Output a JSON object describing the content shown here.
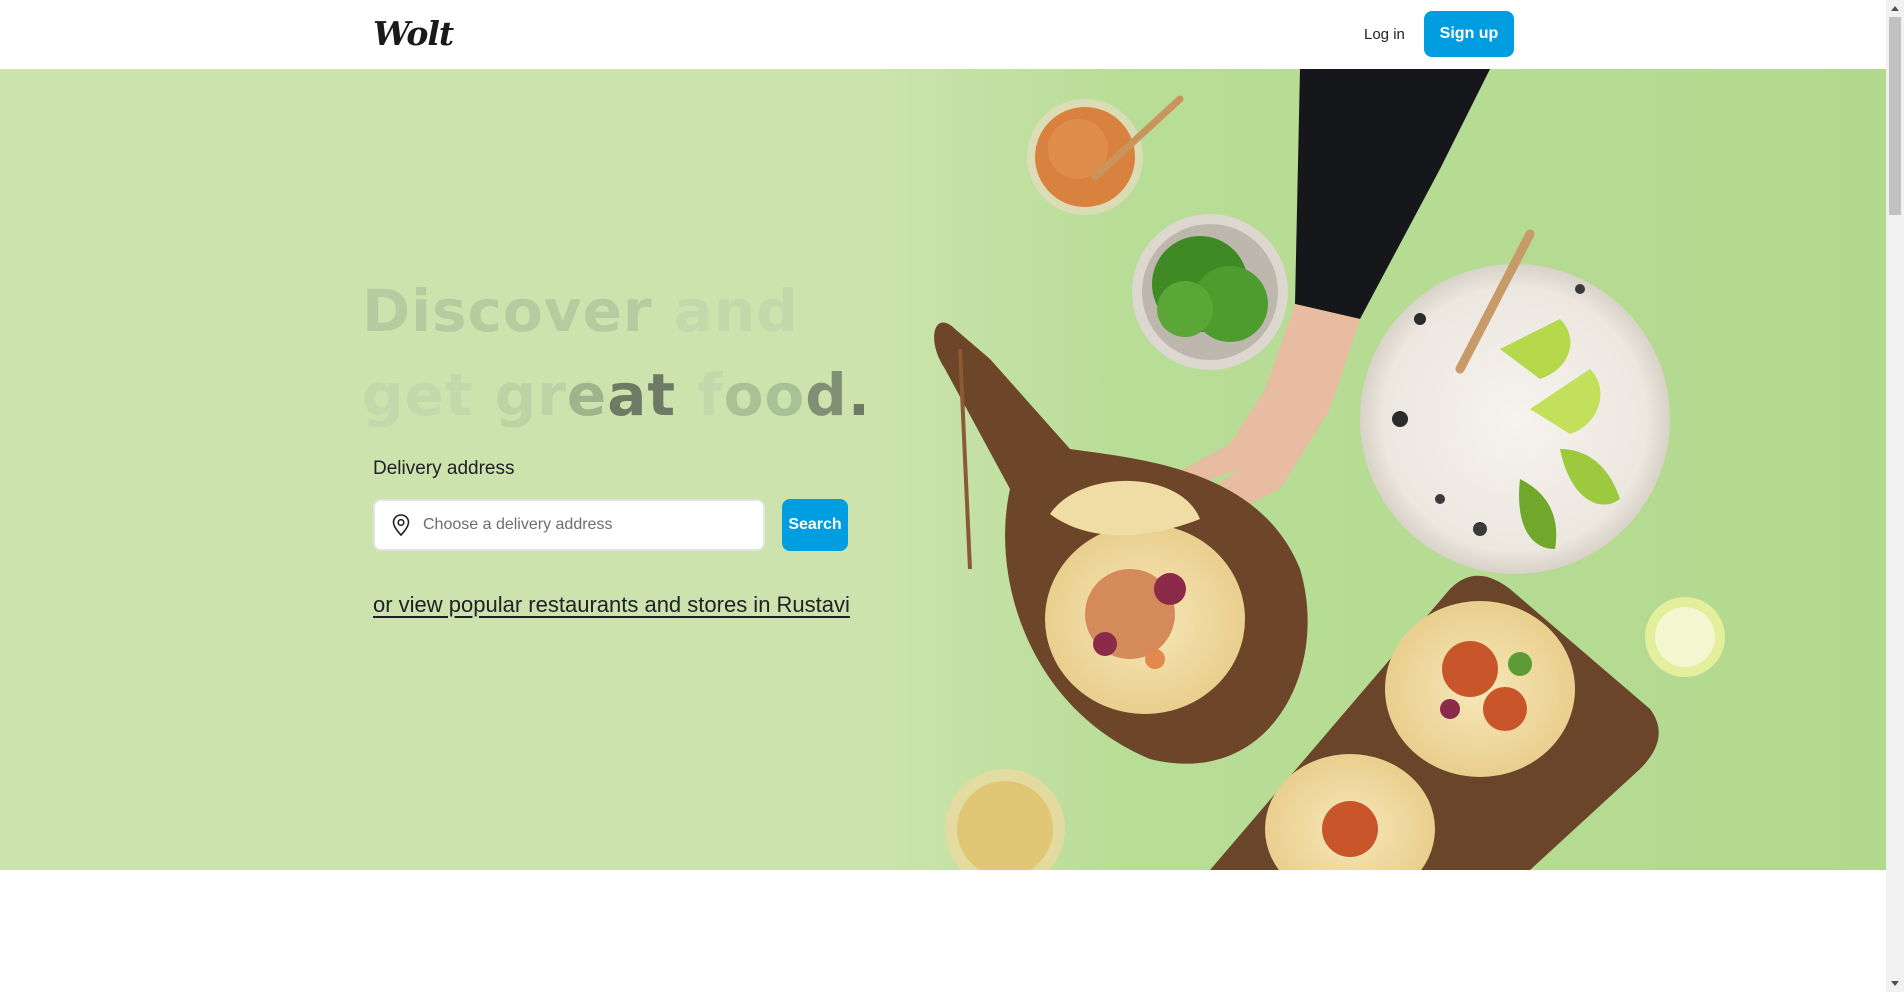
{
  "header": {
    "logo": "Wolt",
    "login_label": "Log in",
    "signup_label": "Sign up"
  },
  "hero": {
    "headline_line1": [
      "Discover",
      "and"
    ],
    "headline_line2": [
      "get",
      "gr",
      "e",
      "at",
      "f",
      "oo",
      "d",
      "."
    ],
    "address_label": "Delivery address",
    "address_placeholder": "Choose a delivery address",
    "address_value": "",
    "search_label": "Search",
    "popular_link": "or view popular restaurants and stores in Rustavi"
  },
  "colors": {
    "brand": "#009de0",
    "hero_background": "#cce3ad",
    "text": "#202125"
  },
  "icons": {
    "address": "location-pin-icon"
  }
}
